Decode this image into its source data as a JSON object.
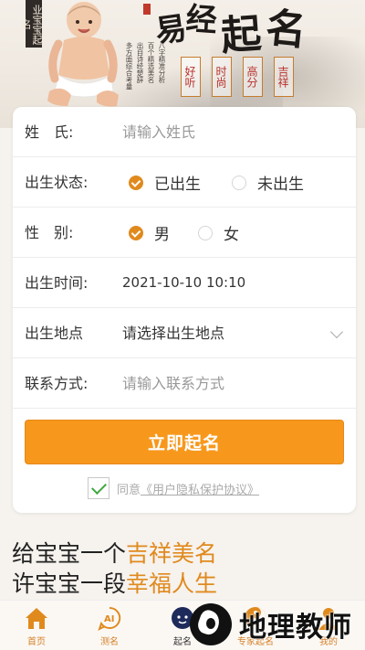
{
  "banner": {
    "vertical_tag": "业宝宝起名",
    "title_chars": [
      "易",
      "经",
      "起",
      "名"
    ],
    "poem_lines": [
      "八字精准分析",
      "百个精选美名",
      "出自诗经楚辞",
      "多方面综合考量"
    ],
    "attributes": [
      "好听",
      "时尚",
      "高分",
      "吉祥"
    ]
  },
  "form": {
    "surname": {
      "label": "姓　氏:",
      "placeholder": "请输入姓氏"
    },
    "birth_status": {
      "label": "出生状态:",
      "options": [
        {
          "text": "已出生",
          "selected": true
        },
        {
          "text": "未出生",
          "selected": false
        }
      ]
    },
    "gender": {
      "label": "性　别:",
      "options": [
        {
          "text": "男",
          "selected": true
        },
        {
          "text": "女",
          "selected": false
        }
      ]
    },
    "birth_time": {
      "label": "出生时间:",
      "value": "2021-10-10 10:10"
    },
    "birth_place": {
      "label": "出生地点",
      "placeholder": "请选择出生地点"
    },
    "contact": {
      "label": "联系方式:",
      "placeholder": "请输入联系方式"
    },
    "submit_label": "立即起名",
    "agree_prefix": "同意",
    "agree_link": "《用户隐私保护协议》"
  },
  "slogan": {
    "line1_prefix": "给宝宝一个",
    "line1_highlight": "吉祥美名",
    "line2_prefix": "许宝宝一段",
    "line2_highlight": "幸福人生"
  },
  "nav": [
    {
      "label": "首页",
      "icon": "home-icon"
    },
    {
      "label": "测名",
      "icon": "ai-icon"
    },
    {
      "label": "起名",
      "icon": "baby-icon"
    },
    {
      "label": "专家起名",
      "icon": "taiji-icon"
    },
    {
      "label": "我的",
      "icon": "user-icon"
    }
  ],
  "watermark": {
    "text": "地理教师"
  },
  "colors": {
    "accent": "#f7981d",
    "accent_dark": "#e08a1e",
    "check_green": "#3ea83e"
  }
}
